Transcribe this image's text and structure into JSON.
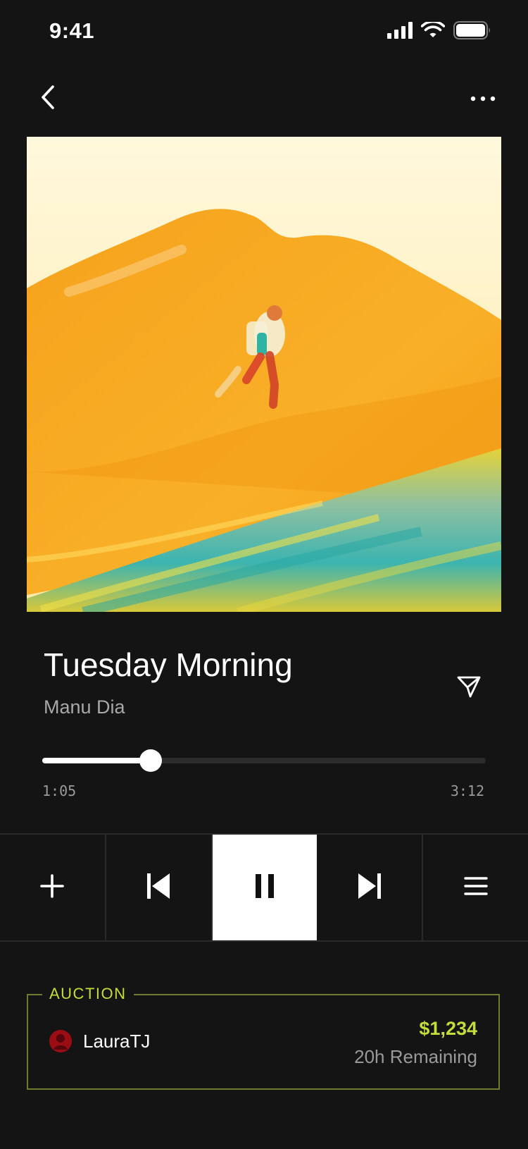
{
  "status_bar": {
    "time": "9:41",
    "icons": [
      "cellular-signal-icon",
      "wifi-icon",
      "battery-icon"
    ]
  },
  "nav": {
    "back_icon": "chevron-left-icon",
    "more_icon": "ellipsis-icon"
  },
  "artwork": {
    "description_icon": "album-artwork"
  },
  "track": {
    "title": "Tuesday Morning",
    "artist": "Manu Dia",
    "share_icon": "send-icon"
  },
  "playback": {
    "elapsed": "1:05",
    "total": "3:12",
    "progress": 0.245
  },
  "controls": [
    {
      "name": "add",
      "icon": "plus-icon"
    },
    {
      "name": "previous",
      "icon": "skip-previous-icon"
    },
    {
      "name": "pause",
      "icon": "pause-icon",
      "active": true
    },
    {
      "name": "next",
      "icon": "skip-next-icon"
    },
    {
      "name": "queue",
      "icon": "menu-icon"
    }
  ],
  "auction": {
    "label": "AUCTION",
    "bidder": "LauraTJ",
    "amount": "$1,234",
    "remaining": "20h Remaining"
  },
  "colors": {
    "background": "#141414",
    "accent": "#c4dc3c",
    "auction_border": "#6e7a2e",
    "muted_text": "#9a9a9a"
  }
}
